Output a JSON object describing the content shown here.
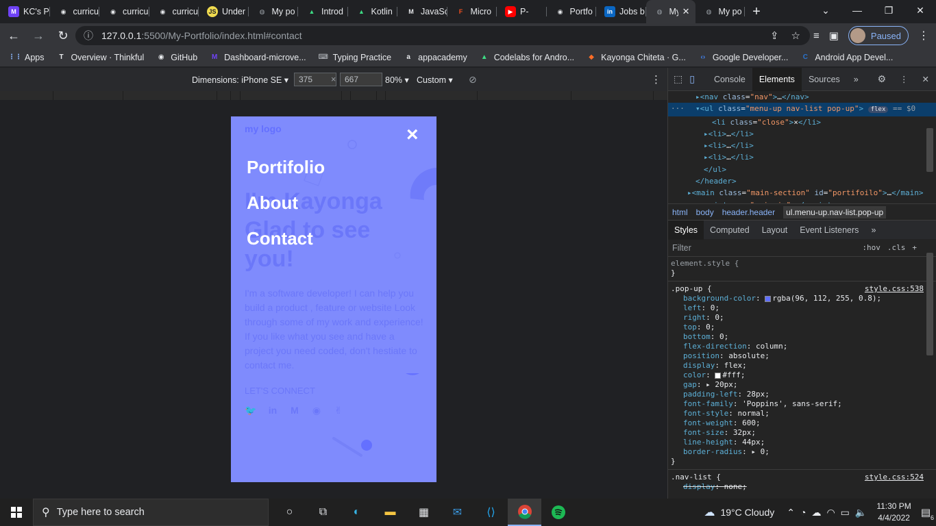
{
  "tabs": [
    {
      "label": "KC's P",
      "icon": "microverse-icon",
      "color": "#6f42f5",
      "glyph": "M"
    },
    {
      "label": "curricu",
      "icon": "github-icon",
      "color": "#e8eaed",
      "glyph": "◉"
    },
    {
      "label": "curricu",
      "icon": "github-icon",
      "color": "#e8eaed",
      "glyph": "◉"
    },
    {
      "label": "curricu",
      "icon": "github-icon",
      "color": "#e8eaed",
      "glyph": "◉"
    },
    {
      "label": "Under",
      "icon": "js-icon",
      "color": "#f0db4f",
      "glyph": "JS"
    },
    {
      "label": "My po",
      "icon": "globe-icon",
      "color": "#9aa0a6",
      "glyph": "◍"
    },
    {
      "label": "Introd",
      "icon": "android-icon",
      "color": "#3ddc84",
      "glyph": "▲"
    },
    {
      "label": "Kotlin",
      "icon": "android-icon",
      "color": "#3ddc84",
      "glyph": "▲"
    },
    {
      "label": "JavaSc",
      "icon": "medium-icon",
      "color": "#e8eaed",
      "glyph": "M"
    },
    {
      "label": "Micro",
      "icon": "figma-icon",
      "color": "#f24e1e",
      "glyph": "F"
    },
    {
      "label": "P-",
      "icon": "youtube-icon",
      "color": "#ff0000",
      "glyph": "▶"
    },
    {
      "label": "Portfo",
      "icon": "github-icon",
      "color": "#e8eaed",
      "glyph": "◉"
    },
    {
      "label": "Jobs b",
      "icon": "linkedin-icon",
      "color": "#0a66c2",
      "glyph": "in"
    },
    {
      "label": "My",
      "icon": "globe-icon",
      "color": "#9aa0a6",
      "glyph": "◍",
      "active": true
    },
    {
      "label": "My po",
      "icon": "globe-icon",
      "color": "#9aa0a6",
      "glyph": "◍"
    }
  ],
  "url": {
    "host": "127.0.0.1",
    "path": ":5500/My-Portfolio/index.html#contact"
  },
  "profile": {
    "label": "Paused"
  },
  "bookmarks": [
    {
      "label": "Apps",
      "icon": "apps-grid-icon",
      "color": "#8ab4f8",
      "glyph": "⋮⋮"
    },
    {
      "label": "Overview · Thinkful",
      "icon": "thinkful-icon",
      "color": "#e8eaed",
      "glyph": "T"
    },
    {
      "label": "GitHub",
      "icon": "github-icon",
      "color": "#e8eaed",
      "glyph": "◉"
    },
    {
      "label": "Dashboard-microve...",
      "icon": "microverse-icon",
      "color": "#6f42f5",
      "glyph": "M"
    },
    {
      "label": "Typing Practice",
      "icon": "typing-icon",
      "color": "#bdc1c6",
      "glyph": "⌨"
    },
    {
      "label": "appacademy",
      "icon": "appacademy-icon",
      "color": "#e8eaed",
      "glyph": "a"
    },
    {
      "label": "Codelabs for Andro...",
      "icon": "android-icon",
      "color": "#3ddc84",
      "glyph": "▲"
    },
    {
      "label": "Kayonga Chiteta · G...",
      "icon": "gitlab-icon",
      "color": "#fc6d26",
      "glyph": "◆"
    },
    {
      "label": "Google Developer...",
      "icon": "google-dev-icon",
      "color": "#4285f4",
      "glyph": "‹›"
    },
    {
      "label": "Android App Devel...",
      "icon": "coursera-icon",
      "color": "#2a73cc",
      "glyph": "C"
    }
  ],
  "device_toolbar": {
    "dimensions_label": "Dimensions: iPhone SE",
    "width": "375",
    "height": "667",
    "zoom": "80%",
    "throttle": "Custom"
  },
  "page": {
    "logo": "my logo",
    "close": "×",
    "menu": [
      "Portifolio",
      "About",
      "Contact"
    ],
    "headline": [
      "I'm Kayonga",
      "Glad to see",
      "you!"
    ],
    "description": "I'm a software developer! I can help you build a product , feature or website Look through some of my work and experience! If you like what you see and have a project you need coded, don't hestiate to contact me.",
    "connect": "LET'S CONNECT",
    "socials": [
      {
        "icon": "twitter-icon",
        "glyph": "🐦"
      },
      {
        "icon": "linkedin-icon",
        "glyph": "in"
      },
      {
        "icon": "medium-icon",
        "glyph": "M"
      },
      {
        "icon": "github-icon",
        "glyph": "◉"
      },
      {
        "icon": "angellist-icon",
        "glyph": "✌"
      }
    ]
  },
  "devtools": {
    "tabs": [
      "Console",
      "Elements",
      "Sources"
    ],
    "active_tab": "Elements",
    "dom": [
      {
        "indent": 3,
        "html": "<span class=\"tag\">▸&lt;nav</span> <span class=\"attr\">class</span>=<span class=\"val\">\"nav\"</span><span class=\"tag\">&gt;</span>…<span class=\"tag\">&lt;/nav&gt;</span>"
      },
      {
        "indent": 3,
        "sel": true,
        "html": "<span class=\"tag\">▾&lt;ul</span> <span class=\"attr\">class</span>=<span class=\"val\">\"menu-up nav-list pop-up\"</span><span class=\"tag\">&gt;</span> <span style=\"background:#3b4c6b;border-radius:6px;padding:0 4px;font-size:9px\">flex</span> <span style=\"color:#9aa0a6\">== $0</span>"
      },
      {
        "indent": 5,
        "html": "<span class=\"tag\">&lt;li</span> <span class=\"attr\">class</span>=<span class=\"val\">\"close\"</span><span class=\"tag\">&gt;</span>×<span class=\"tag\">&lt;/li&gt;</span>"
      },
      {
        "indent": 4,
        "html": "<span class=\"tag\">▸&lt;li&gt;</span>…<span class=\"tag\">&lt;/li&gt;</span>"
      },
      {
        "indent": 4,
        "html": "<span class=\"tag\">▸&lt;li&gt;</span>…<span class=\"tag\">&lt;/li&gt;</span>"
      },
      {
        "indent": 4,
        "html": "<span class=\"tag\">▸&lt;li&gt;</span>…<span class=\"tag\">&lt;/li&gt;</span>"
      },
      {
        "indent": 4,
        "html": "<span class=\"tag\">&lt;/ul&gt;</span>"
      },
      {
        "indent": 3,
        "html": "<span class=\"tag\">&lt;/header&gt;</span>"
      },
      {
        "indent": 2,
        "html": "<span class=\"tag\">▸&lt;main</span> <span class=\"attr\">class</span>=<span class=\"val\">\"main-section\"</span> <span class=\"attr\">id</span>=<span class=\"val\">\"portifoilo\"</span><span class=\"tag\">&gt;</span>…<span class=\"tag\">&lt;/main&gt;</span>"
      },
      {
        "indent": 3,
        "html": "<span class=\"tag\">&lt;script</span> <span class=\"attr\">src</span>=<span class=\"val\">\"main.js\"</span><span class=\"tag\">&gt;&lt;/script&gt;</span>"
      }
    ],
    "breadcrumbs": [
      "html",
      "body",
      "header.header",
      "ul.menu-up.nav-list.pop-up"
    ],
    "style_tabs": [
      "Styles",
      "Computed",
      "Layout",
      "Event Listeners"
    ],
    "filter_placeholder": "Filter",
    "filter_tools": [
      ":hov",
      ".cls",
      "+"
    ],
    "element_style": "element.style {",
    "rules": [
      {
        "selector": ".pop-up {",
        "source": "style.css:538",
        "props": [
          {
            "name": "background-color",
            "value": "rgba(96, 112, 255, 0.8);",
            "swatch": "#6070ff"
          },
          {
            "name": "left",
            "value": "0;"
          },
          {
            "name": "right",
            "value": "0;"
          },
          {
            "name": "top",
            "value": "0;"
          },
          {
            "name": "bottom",
            "value": "0;"
          },
          {
            "name": "flex-direction",
            "value": "column;"
          },
          {
            "name": "position",
            "value": "absolute;"
          },
          {
            "name": "display",
            "value": "flex;"
          },
          {
            "name": "color",
            "value": "#fff;",
            "swatch": "#ffffff"
          },
          {
            "name": "gap",
            "value": "▸ 20px;"
          },
          {
            "name": "padding-left",
            "value": "28px;"
          },
          {
            "name": "font-family",
            "value": "'Poppins', sans-serif;"
          },
          {
            "name": "font-style",
            "value": "normal;"
          },
          {
            "name": "font-weight",
            "value": "600;"
          },
          {
            "name": "font-size",
            "value": "32px;"
          },
          {
            "name": "line-height",
            "value": "44px;"
          },
          {
            "name": "border-radius",
            "value": "▸ 0;"
          }
        ]
      },
      {
        "selector": ".nav-list {",
        "source": "style.css:524",
        "props": [
          {
            "name": "display",
            "value": "none;",
            "strike": true
          }
        ]
      }
    ]
  },
  "taskbar": {
    "search_placeholder": "Type here to search",
    "weather": "19°C  Cloudy",
    "time": "11:30 PM",
    "date": "4/4/2022",
    "notifications": "6"
  }
}
